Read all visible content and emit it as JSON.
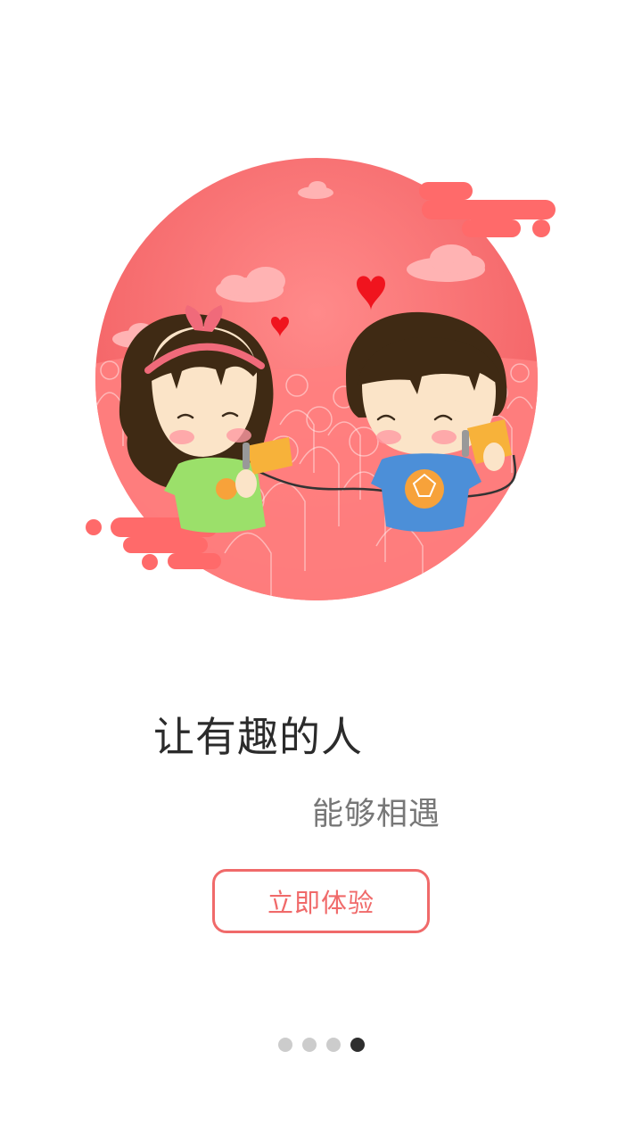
{
  "onboarding": {
    "headline": "让有趣的人",
    "subline": "能够相遇",
    "cta_label": "立即体验",
    "illustration_icon": "couple-tin-can-phone-illustration",
    "page_indicator": {
      "total": 4,
      "active_index": 3
    }
  },
  "colors": {
    "accent": "#f06a6a",
    "illustration_bg": "#ff6a6a",
    "dot_inactive": "#cccccc",
    "dot_active": "#2e2e2e"
  }
}
